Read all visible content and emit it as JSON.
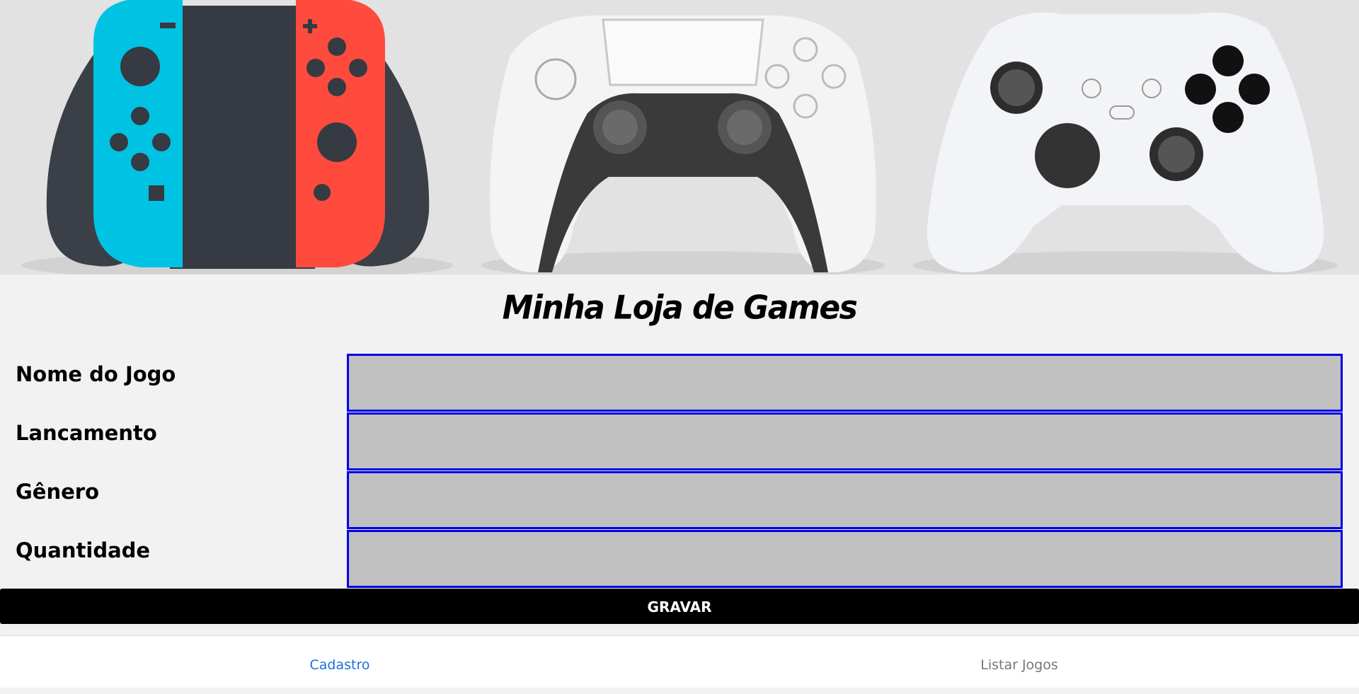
{
  "banner": {
    "alt_consoles": [
      "nintendo-switch-controller",
      "playstation-dualsense-controller",
      "xbox-controller"
    ]
  },
  "title": "Minha Loja de Games",
  "form": {
    "fields": [
      {
        "label": "Nome do Jogo",
        "value": "",
        "placeholder": ""
      },
      {
        "label": "Lancamento",
        "value": "",
        "placeholder": ""
      },
      {
        "label": "Gênero",
        "value": "",
        "placeholder": ""
      },
      {
        "label": "Quantidade",
        "value": "",
        "placeholder": ""
      }
    ],
    "submit_label": "GRAVAR"
  },
  "tabs": [
    {
      "label": "Cadastro",
      "active": true
    },
    {
      "label": "Listar Jogos",
      "active": false
    }
  ],
  "colors": {
    "input_bg": "#c0c0c0",
    "input_border": "#0000e6",
    "button_bg": "#000000",
    "tab_active": "#1e6fd9",
    "tab_inactive": "#777777",
    "joycon_left": "#00c3e3",
    "joycon_right": "#ff4b3d"
  }
}
